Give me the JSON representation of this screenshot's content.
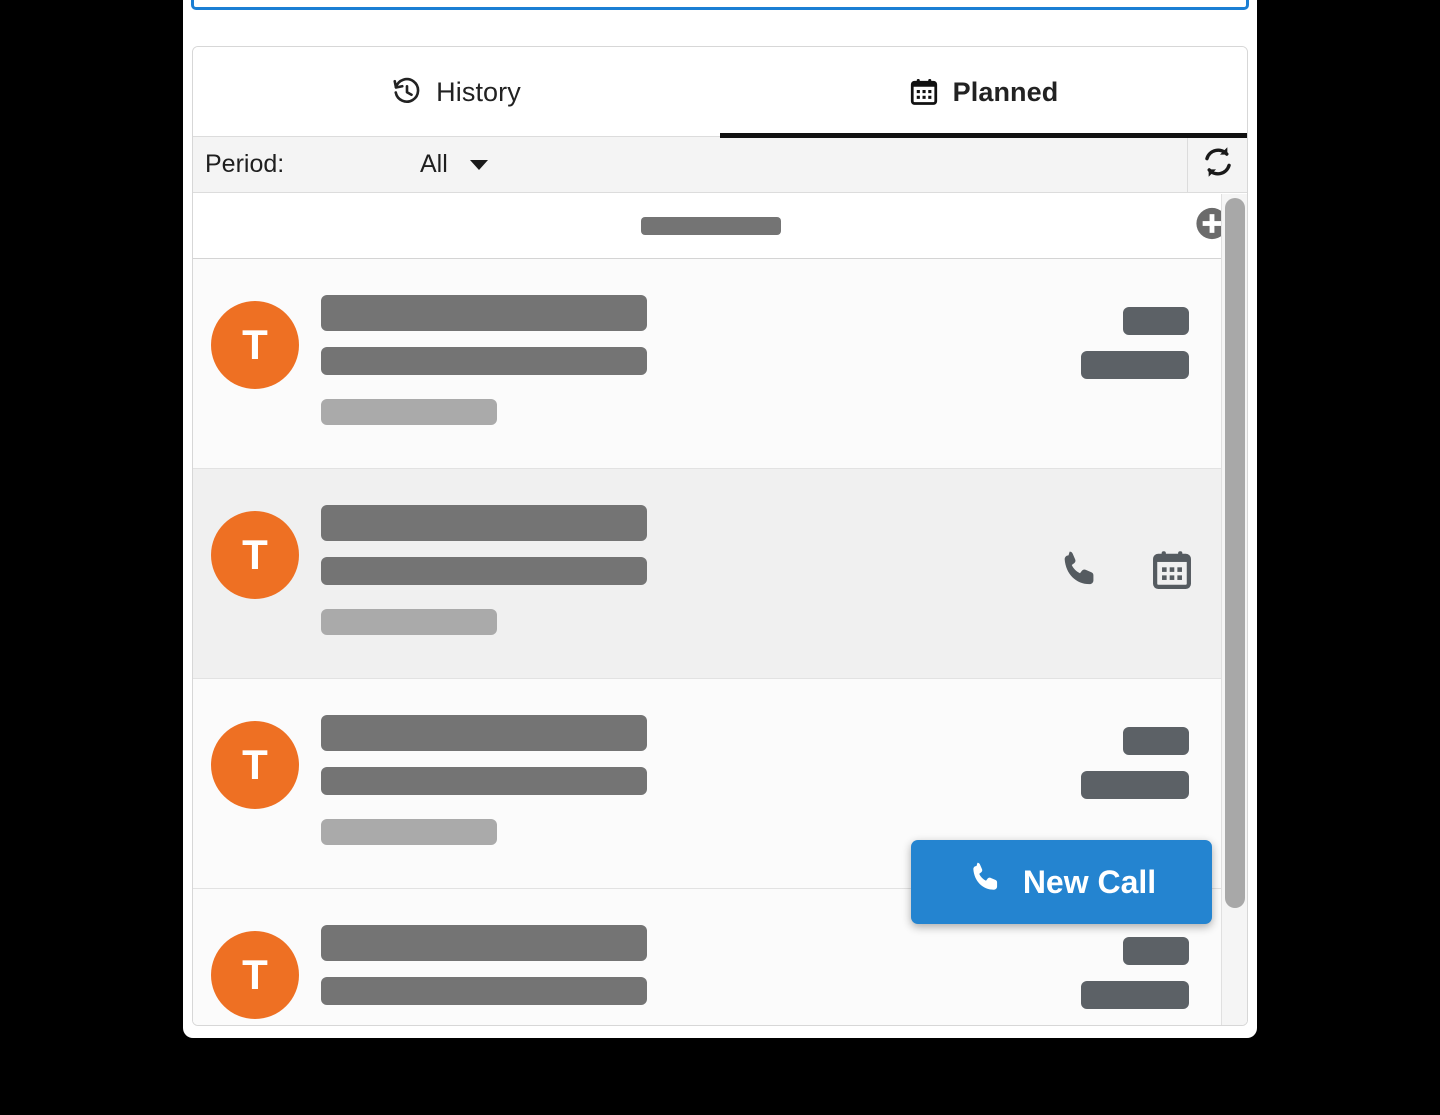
{
  "window": {
    "focused_input_value": "",
    "background_color": "#000000",
    "accent_blue": "#2484d0",
    "avatar_color": "#ee7023"
  },
  "tabs": [
    {
      "id": "history",
      "label": "History",
      "icon": "history-icon",
      "active": false
    },
    {
      "id": "planned",
      "label": "Planned",
      "icon": "calendar-icon",
      "active": true
    }
  ],
  "filter": {
    "label": "Period:",
    "selected": "All",
    "options": [
      "All"
    ],
    "caret_icon": "chevron-down-icon",
    "refresh_icon": "refresh-icon"
  },
  "list_header": {
    "title_redacted": "",
    "add_icon": "plus-circle-icon"
  },
  "rows": [
    {
      "avatar_initial": "T",
      "line1_redacted": "",
      "line2_redacted": "",
      "line3_redacted": "",
      "meta_top_redacted": "",
      "meta_bottom_redacted": "",
      "state": "normal"
    },
    {
      "avatar_initial": "T",
      "line1_redacted": "",
      "line2_redacted": "",
      "line3_redacted": "",
      "actions": [
        "phone-icon",
        "calendar-icon"
      ],
      "state": "hovered"
    },
    {
      "avatar_initial": "T",
      "line1_redacted": "",
      "line2_redacted": "",
      "line3_redacted": "",
      "meta_top_redacted": "",
      "meta_bottom_redacted": "",
      "state": "normal"
    },
    {
      "avatar_initial": "T",
      "line1_redacted": "",
      "line2_redacted": "",
      "meta_top_redacted": "",
      "meta_bottom_redacted": "",
      "state": "normal"
    }
  ],
  "new_call_button": {
    "label": "New Call",
    "icon": "phone-icon",
    "color": "#2484d0"
  },
  "scrollbar": {
    "orientation": "vertical",
    "thumb_color": "#a8a8a8"
  }
}
